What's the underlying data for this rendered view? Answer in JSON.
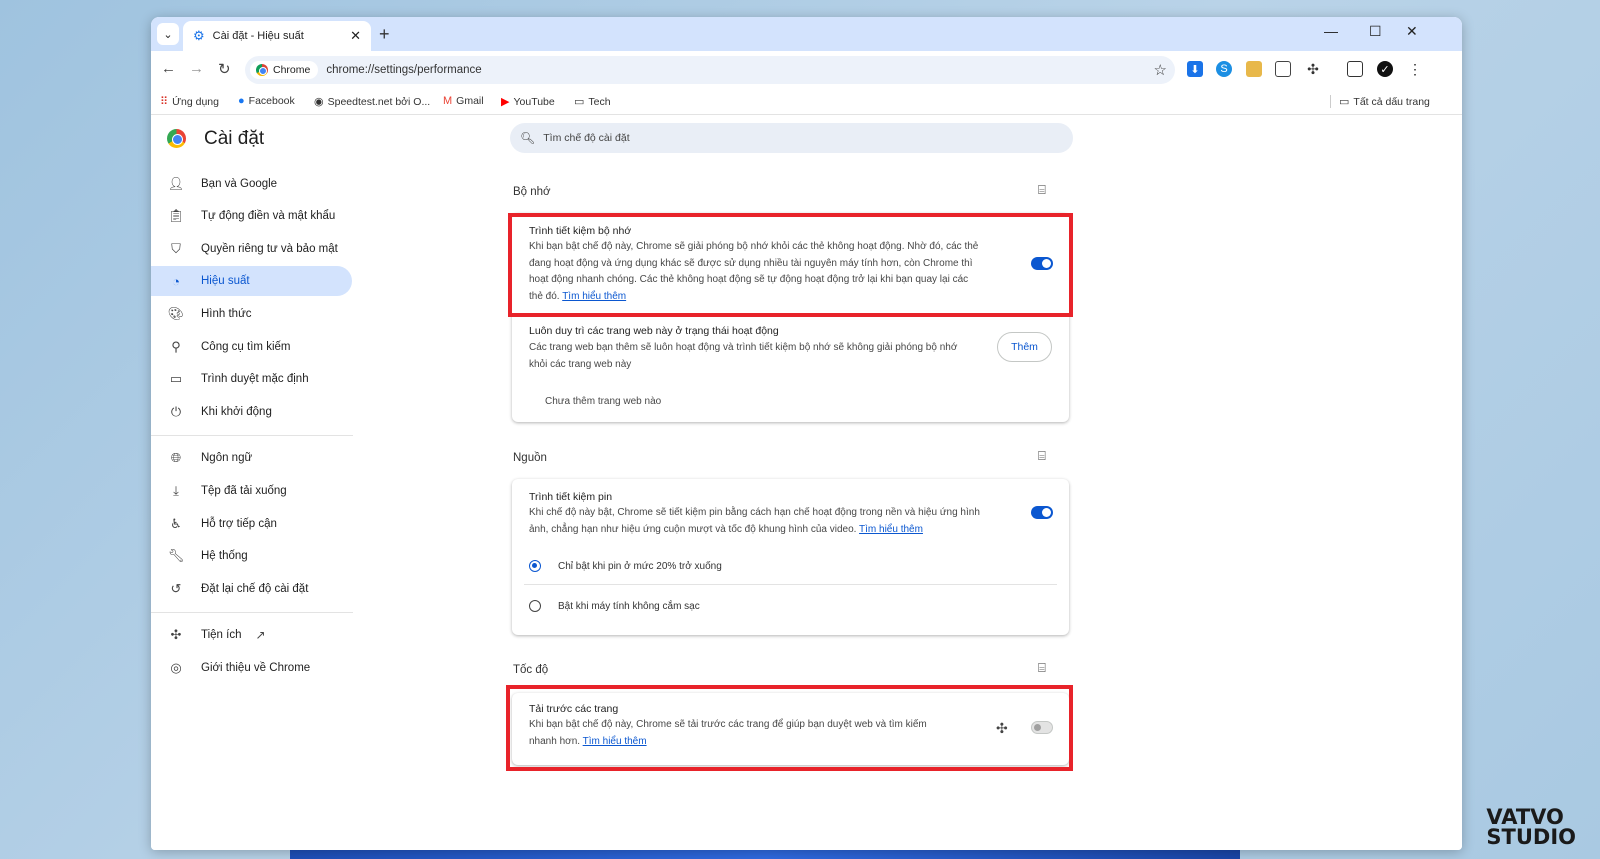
{
  "tab": {
    "title": "Cài đặt - Hiệu suất",
    "close": "✕"
  },
  "window_controls": {
    "minimize": "—",
    "maximize": "☐",
    "close": "✕"
  },
  "toolbar": {
    "chip_label": "Chrome",
    "url": "chrome://settings/performance"
  },
  "bookmarks": {
    "items": [
      {
        "label": "Ứng dụng",
        "icon": "apps-grid-icon"
      },
      {
        "label": "Facebook",
        "icon": "facebook-icon"
      },
      {
        "label": "Speedtest.net bởi O...",
        "icon": "speedtest-icon"
      },
      {
        "label": "Gmail",
        "icon": "gmail-icon"
      },
      {
        "label": "YouTube",
        "icon": "youtube-icon"
      },
      {
        "label": "Tech",
        "icon": "folder-icon"
      }
    ],
    "all_bookmarks": "Tất cả dấu trang"
  },
  "settings": {
    "title": "Cài đặt",
    "search_placeholder": "Tìm chế độ cài đặt"
  },
  "sidebar": {
    "items": [
      {
        "label": "Bạn và Google",
        "icon": "person-icon"
      },
      {
        "label": "Tự động điền và mật khẩu",
        "icon": "clipboard-icon"
      },
      {
        "label": "Quyền riêng tư và bảo mật",
        "icon": "shield-icon"
      },
      {
        "label": "Hiệu suất",
        "icon": "speedometer-icon",
        "active": true
      },
      {
        "label": "Hình thức",
        "icon": "palette-icon"
      },
      {
        "label": "Công cụ tìm kiếm",
        "icon": "search-icon"
      },
      {
        "label": "Trình duyệt mặc định",
        "icon": "browser-icon"
      },
      {
        "label": "Khi khởi động",
        "icon": "power-icon"
      },
      {
        "label": "Ngôn ngữ",
        "icon": "globe-icon"
      },
      {
        "label": "Tệp đã tải xuống",
        "icon": "download-icon"
      },
      {
        "label": "Hỗ trợ tiếp cận",
        "icon": "accessibility-icon"
      },
      {
        "label": "Hệ thống",
        "icon": "wrench-icon"
      },
      {
        "label": "Đặt lại chế độ cài đặt",
        "icon": "history-icon"
      },
      {
        "label": "Tiện ích",
        "icon": "puzzle-icon"
      },
      {
        "label": "Giới thiệu về Chrome",
        "icon": "chrome-icon"
      }
    ]
  },
  "memory": {
    "section_title": "Bộ nhớ",
    "saver_title": "Trình tiết kiệm bộ nhớ",
    "saver_desc_1": "Khi bạn bật chế độ này, Chrome sẽ giải phóng bộ nhớ khỏi các thẻ không hoạt động. Nhờ đó, các thẻ",
    "saver_desc_2": "đang hoạt động và ứng dụng khác sẽ được sử dụng nhiều tài nguyên máy tính hơn, còn Chrome thì",
    "saver_desc_3": "hoạt động nhanh chóng. Các thẻ không hoạt động sẽ tự động hoạt động trở lại khi bạn quay lại các",
    "saver_desc_4": "thẻ đó.",
    "learn_more": "Tìm hiểu thêm",
    "saver_enabled": true,
    "keep_title": "Luôn duy trì các trang web này ở trạng thái hoạt động",
    "keep_desc_1": "Các trang web bạn thêm sẽ luôn hoạt động và trình tiết kiệm bộ nhớ sẽ không giải phóng bộ nhớ",
    "keep_desc_2": "khỏi các trang web này",
    "add_button": "Thêm",
    "empty_text": "Chưa thêm trang web nào"
  },
  "power": {
    "section_title": "Nguồn",
    "saver_title": "Trình tiết kiệm pin",
    "saver_desc_1": "Khi chế độ này bật, Chrome sẽ tiết kiệm pin bằng cách hạn chế hoạt động trong nền và hiệu ứng hình",
    "saver_desc_2": "ảnh, chẳng hạn như hiệu ứng cuộn mượt và tốc độ khung hình của video.",
    "learn_more": "Tìm hiểu thêm",
    "saver_enabled": true,
    "option_1": "Chỉ bật khi pin ở mức 20% trở xuống",
    "option_2": "Bật khi máy tính không cắm sạc",
    "selected_option": 1
  },
  "speed": {
    "section_title": "Tốc độ",
    "preload_title": "Tải trước các trang",
    "preload_desc_1": "Khi bạn bật chế độ này, Chrome sẽ tải trước các trang để giúp bạn duyệt web và tìm kiếm",
    "preload_desc_2": "nhanh hơn.",
    "learn_more": "Tìm hiểu thêm",
    "preload_enabled": false
  },
  "watermark": {
    "line1": "VATVO",
    "line2": "STUDIO"
  },
  "colors": {
    "accent": "#0b57d0",
    "highlight": "#e8232a",
    "tabstrip": "#d3e3fd"
  }
}
